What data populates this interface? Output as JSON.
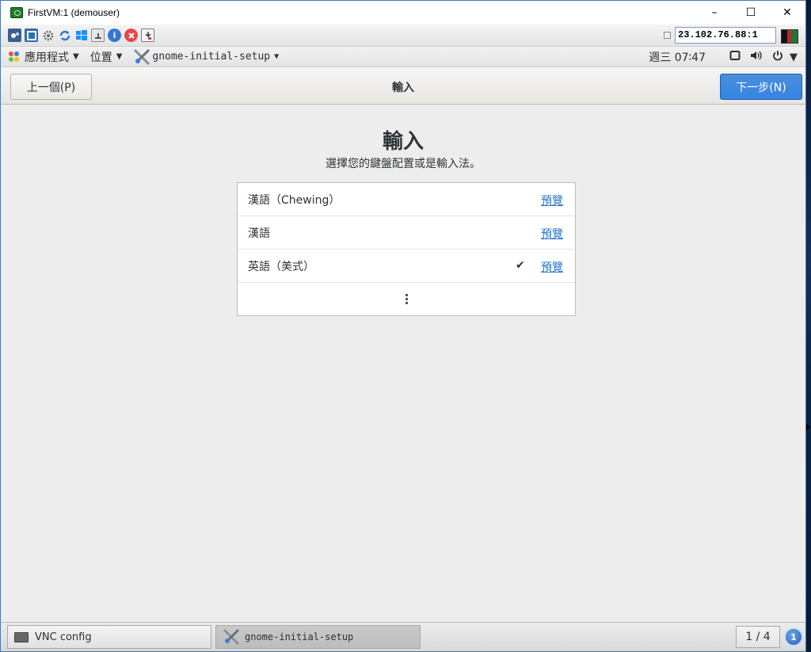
{
  "window": {
    "title": "FirstVM:1 (demouser)",
    "minimize": "–",
    "maximize": "☐",
    "close": "✕"
  },
  "vnc_toolbar": {
    "address": "23.102.76.88:1",
    "icons": [
      "options-icon",
      "fullscreen-icon",
      "settings-icon",
      "refresh-icon",
      "windows-key-icon",
      "ctrl-alt-del-icon",
      "info-icon",
      "disconnect-icon",
      "file-transfer-icon"
    ]
  },
  "gnome_panel": {
    "applications": "應用程式",
    "places": "位置",
    "app_name": "gnome-initial-setup",
    "clock": "週三 07∶47"
  },
  "headerbar": {
    "prev_label": "上一個(P)",
    "title": "輸入",
    "next_label": "下一步(N)"
  },
  "main": {
    "heading": "輸入",
    "subtitle": "選擇您的鍵盤配置或是輸入法。",
    "inputs": [
      {
        "name": "漢語（Chewing）",
        "preview": "預覽",
        "selected": false
      },
      {
        "name": "漢語",
        "preview": "預覽",
        "selected": false
      },
      {
        "name": "英語（美式）",
        "preview": "預覽",
        "selected": true
      }
    ],
    "check_mark": "✔"
  },
  "taskbar": {
    "tasks": [
      {
        "label": "VNC config"
      },
      {
        "label": "gnome-initial-setup"
      }
    ],
    "pager": "1 / 4",
    "notification_count": "1"
  },
  "colors": {
    "accent": "#3584e4",
    "link": "#2a76c6",
    "content_bg": "#ededed"
  }
}
